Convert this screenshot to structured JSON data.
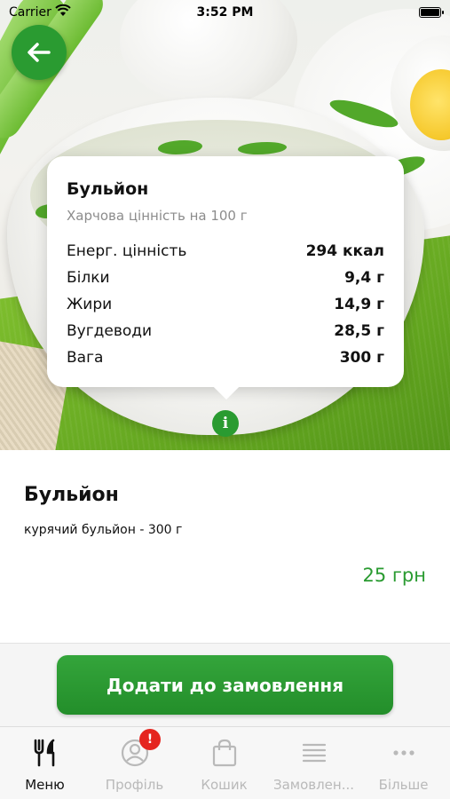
{
  "status_bar": {
    "carrier": "Carrier",
    "time": "3:52 PM"
  },
  "popover": {
    "title": "Бульйон",
    "subtitle": "Харчова цінність на 100 г",
    "rows": [
      {
        "label": "Енерг. цінність",
        "value": "294 ккал"
      },
      {
        "label": "Білки",
        "value": "9,4 г"
      },
      {
        "label": "Жири",
        "value": "14,9 г"
      },
      {
        "label": "Вугдеводи",
        "value": "28,5 г"
      },
      {
        "label": "Вага",
        "value": "300 г"
      }
    ]
  },
  "info_badge": "i",
  "product": {
    "title": "Бульйон",
    "description": "курячий бульйон - 300 г",
    "price": "25 грн"
  },
  "cta": {
    "label": "Додати до замовлення"
  },
  "tabs": [
    {
      "label": "Меню",
      "icon": "fork-knife-icon",
      "active": true
    },
    {
      "label": "Профіль",
      "icon": "profile-icon",
      "badge": "!"
    },
    {
      "label": "Кошик",
      "icon": "bag-icon"
    },
    {
      "label": "Замовлен...",
      "icon": "list-icon"
    },
    {
      "label": "Більше",
      "icon": "more-icon"
    }
  ],
  "colors": {
    "accent": "#2a9b31",
    "badge": "#e5251f"
  }
}
